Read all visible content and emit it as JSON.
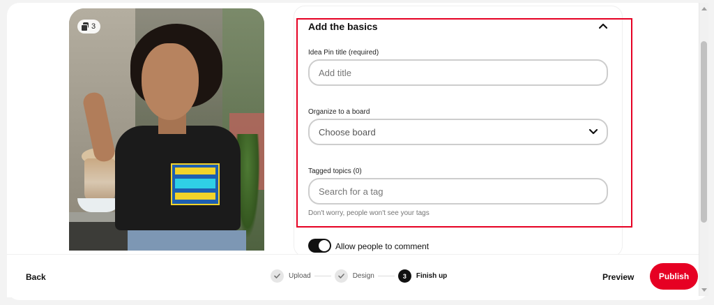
{
  "preview": {
    "image_count": "3"
  },
  "basics": {
    "title": "Add the basics",
    "pin_title_label": "Idea Pin title (required)",
    "pin_title_placeholder": "Add title",
    "board_label": "Organize to a board",
    "board_value": "Choose board",
    "topics_label": "Tagged topics (0)",
    "topics_placeholder": "Search for a tag",
    "topics_hint": "Don't worry, people won't see your tags",
    "comments_label": "Allow people to comment",
    "comments_enabled": true
  },
  "footer": {
    "back_label": "Back",
    "steps": [
      {
        "label": "Upload",
        "state": "done"
      },
      {
        "label": "Design",
        "state": "done"
      },
      {
        "label": "Finish up",
        "state": "active",
        "number": "3"
      }
    ],
    "preview_label": "Preview",
    "publish_label": "Publish"
  },
  "colors": {
    "accent": "#e60023",
    "highlight": "#e60023"
  }
}
